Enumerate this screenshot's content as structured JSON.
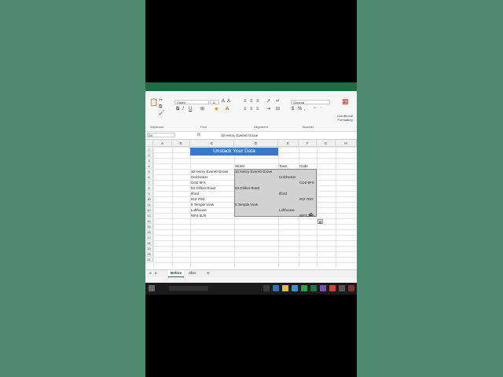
{
  "ribbon": {
    "font_name": "Calibri",
    "font_size": "11",
    "number_format": "General",
    "groups": [
      "Clipboard",
      "Font",
      "Alignment",
      "Number"
    ],
    "conditional_formatting": "Conditional Formatting"
  },
  "formula_bar": {
    "name_box": "D4",
    "fx": "fx",
    "content": "10 Henry Everett Grove"
  },
  "columns": [
    "A",
    "B",
    "C",
    "D",
    "E",
    "F",
    "G",
    "H"
  ],
  "rows": [
    "1",
    "2",
    "3",
    "4",
    "5",
    "6",
    "7",
    "8",
    "9",
    "10",
    "11",
    "12",
    "13",
    "14",
    "15",
    "16",
    "17",
    "18",
    "19",
    "20",
    "21"
  ],
  "sheet": {
    "title": "Unstack Your Data",
    "headers": [
      "Street",
      "Town",
      "Code"
    ],
    "source_list": [
      "10 Henry Everett Grove",
      "Colchester",
      "CO2 9FX",
      "53 Clifton Road",
      "Ilford",
      "IG2 7DG",
      "5 Temple View",
      "Lofthouse",
      "WF3 3LN"
    ],
    "unstacked": {
      "street": [
        "10 Henry Everett Grove",
        "53 Clifton Road",
        "5 Temple View"
      ],
      "town": [
        "Colchester",
        "Ilford",
        "Lofthouse"
      ],
      "code": [
        "CO2 9FX",
        "IG2 7DG",
        "WF3 3LN"
      ]
    }
  },
  "tabs": [
    "Before",
    "After"
  ],
  "colors": {
    "title_fill": "#3c78c8",
    "excel_green": "#217346",
    "background": "#4e8a6f"
  }
}
